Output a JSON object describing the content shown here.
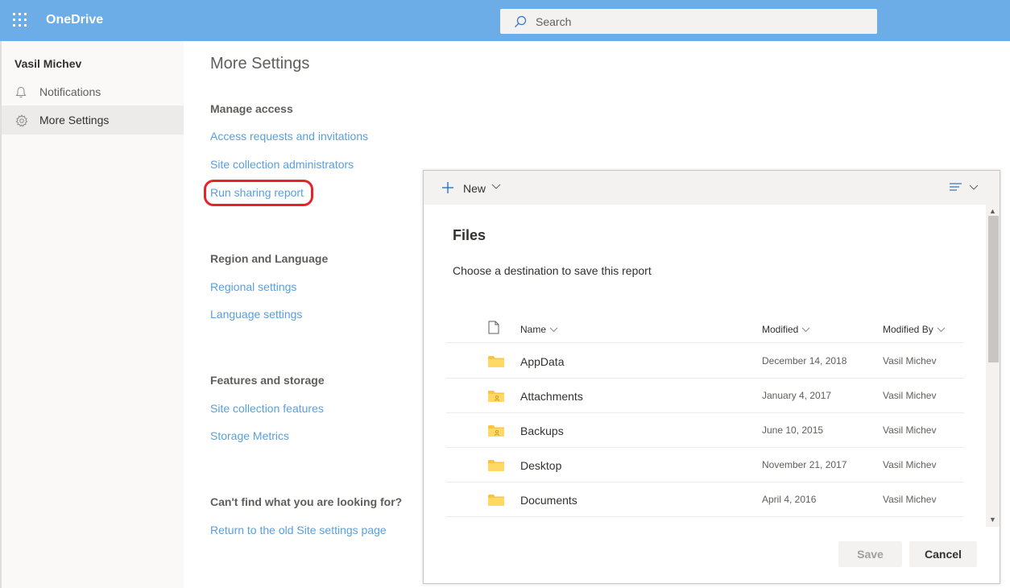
{
  "header": {
    "app_name": "OneDrive",
    "search_placeholder": "Search"
  },
  "sidebar": {
    "user_name": "Vasil Michev",
    "items": [
      {
        "label": "Notifications",
        "icon": "bell-icon"
      },
      {
        "label": "More Settings",
        "icon": "gear-icon",
        "active": true
      }
    ]
  },
  "main": {
    "title": "More Settings",
    "sections": [
      {
        "heading": "Manage access",
        "links": [
          "Access requests and invitations",
          "Site collection administrators",
          "Run sharing report"
        ]
      },
      {
        "heading": "Region and Language",
        "links": [
          "Regional settings",
          "Language settings"
        ]
      },
      {
        "heading": "Features and storage",
        "links": [
          "Site collection features",
          "Storage Metrics"
        ]
      },
      {
        "heading": "Can't find what you are looking for?",
        "links": [
          "Return to the old Site settings page"
        ]
      }
    ],
    "highlight_color": "#e8222b"
  },
  "dialog": {
    "new_label": "New",
    "title": "Files",
    "subtitle": "Choose a destination to save this report",
    "columns": {
      "name": "Name",
      "modified": "Modified",
      "modified_by": "Modified By"
    },
    "rows": [
      {
        "name": "AppData",
        "modified": "December 14, 2018",
        "modified_by": "Vasil Michev",
        "shared": false
      },
      {
        "name": "Attachments",
        "modified": "January 4, 2017",
        "modified_by": "Vasil Michev",
        "shared": true
      },
      {
        "name": "Backups",
        "modified": "June 10, 2015",
        "modified_by": "Vasil Michev",
        "shared": true
      },
      {
        "name": "Desktop",
        "modified": "November 21, 2017",
        "modified_by": "Vasil Michev",
        "shared": false
      },
      {
        "name": "Documents",
        "modified": "April 4, 2016",
        "modified_by": "Vasil Michev",
        "shared": false
      }
    ],
    "save_label": "Save",
    "cancel_label": "Cancel"
  },
  "colors": {
    "header_bg": "#6cade8",
    "link": "#5a9fdc",
    "folder": "#ffb900"
  }
}
